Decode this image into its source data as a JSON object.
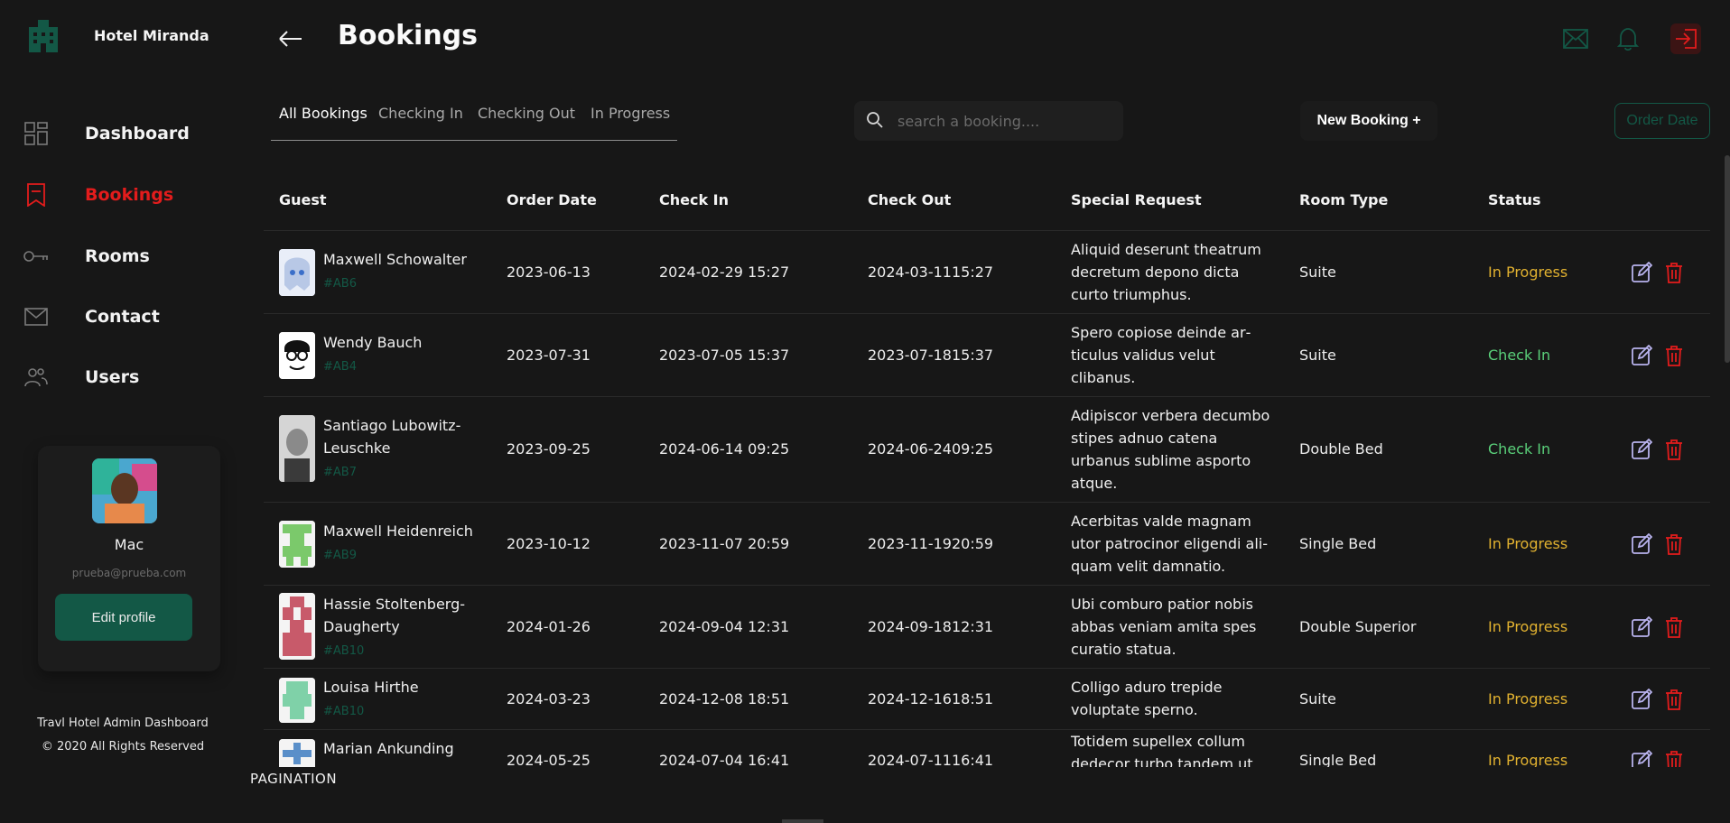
{
  "brand": {
    "name": "Hotel Miranda",
    "logo_icon": "hotel-building-icon",
    "logo_color": "#135846"
  },
  "sidebar": {
    "items": [
      {
        "label": "Dashboard",
        "icon": "dashboard-grid-icon",
        "active": false
      },
      {
        "label": "Bookings",
        "icon": "bookmark-icon",
        "active": true
      },
      {
        "label": "Rooms",
        "icon": "key-icon",
        "active": false
      },
      {
        "label": "Contact",
        "icon": "envelope-icon",
        "active": false
      },
      {
        "label": "Users",
        "icon": "users-icon",
        "active": false
      }
    ],
    "active_color": "#e31c1c"
  },
  "profile": {
    "name": "Mac",
    "email": "prueba@prueba.com",
    "edit_label": "Edit profile"
  },
  "footer": {
    "line1": "Travl Hotel Admin Dashboard",
    "line2": "© 2020 All Rights Reserved"
  },
  "header": {
    "title": "Bookings",
    "icons": [
      "back-arrow-icon",
      "mail-icon",
      "bell-icon",
      "logout-icon"
    ]
  },
  "tabs": [
    "All Bookings",
    "Checking In",
    "Checking Out",
    "In Progress"
  ],
  "search": {
    "placeholder": "search a booking...."
  },
  "actions": {
    "new_booking": "New Booking +",
    "order_date": "Order Date"
  },
  "table": {
    "headers": [
      "Guest",
      "Order Date",
      "Check In",
      "Check Out",
      "Special Request",
      "Room Type",
      "Status"
    ],
    "rows": [
      {
        "name": "Maxwell Schowalter",
        "id": "#AB6",
        "order_date": "2023-06-13",
        "check_in": "2024-02-29 15:27",
        "check_out": "2024-03-1115:27",
        "request": "Aliquid deserunt theatrum decretum depono dicta curto triumphus.",
        "room": "Suite",
        "status": "In Progress"
      },
      {
        "name": "Wendy Bauch",
        "id": "#AB4",
        "order_date": "2023-07-31",
        "check_in": "2023-07-05 15:37",
        "check_out": "2023-07-1815:37",
        "request": "Spero copiose deinde ar­ticulus validus velut clibanus.",
        "room": "Suite",
        "status": "Check In"
      },
      {
        "name": "Santiago Lubowitz-Leuschke",
        "id": "#AB7",
        "order_date": "2023-09-25",
        "check_in": "2024-06-14 09:25",
        "check_out": "2024-06-2409:25",
        "request": "Adipiscor verbera de­cumbo stipes adnuo catena urbanus sublime asporto atque.",
        "room": "Double Bed",
        "status": "Check In"
      },
      {
        "name": "Maxwell Heidenreich",
        "id": "#AB9",
        "order_date": "2023-10-12",
        "check_in": "2023-11-07 20:59",
        "check_out": "2023-11-1920:59",
        "request": "Acerbitas valde magnam utor patrocinor eligendi ali­quam velit damnatio.",
        "room": "Single Bed",
        "status": "In Progress"
      },
      {
        "name": "Hassie Stoltenberg-Daugherty",
        "id": "#AB10",
        "order_date": "2024-01-26",
        "check_in": "2024-09-04 12:31",
        "check_out": "2024-09-1812:31",
        "request": "Ubi comburo patior nobis abbas veniam amita spes curatio statua.",
        "room": "Double Superior",
        "status": "In Progress"
      },
      {
        "name": "Louisa Hirthe",
        "id": "#AB10",
        "order_date": "2024-03-23",
        "check_in": "2024-12-08 18:51",
        "check_out": "2024-12-1618:51",
        "request": "Colligo aduro trepide voluptate sperno.",
        "room": "Suite",
        "status": "In Progress"
      },
      {
        "name": "Marian Ankunding",
        "id": "",
        "order_date": "2024-05-25",
        "check_in": "2024-07-04 16:41",
        "check_out": "2024-07-1116:41",
        "request": "Totidem supellex collum dedecor turbo tandem ut.",
        "room": "Single Bed",
        "status": "In Progress"
      }
    ],
    "action_icons": [
      "edit-icon",
      "trash-icon"
    ]
  },
  "pagination": {
    "label": "PAGINATION"
  }
}
